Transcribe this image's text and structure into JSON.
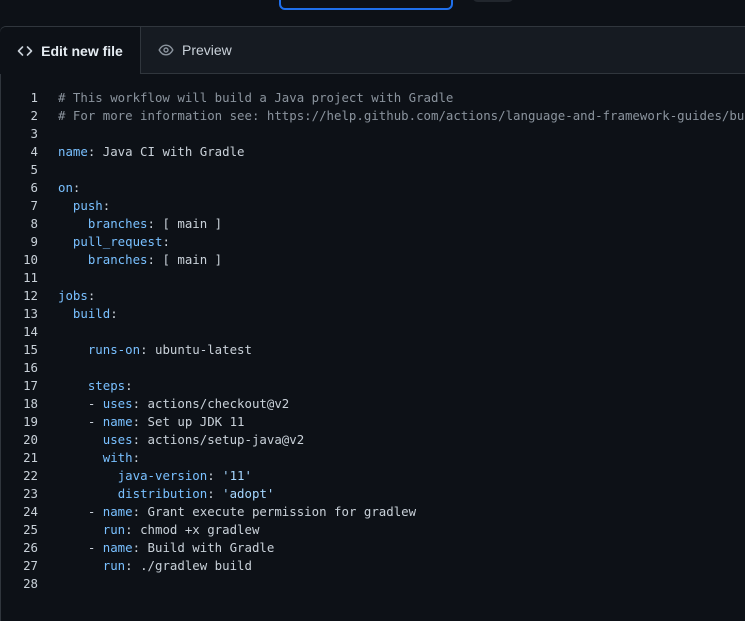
{
  "tabs": {
    "edit_label": "Edit new file",
    "preview_label": "Preview"
  },
  "code_lines": [
    [
      {
        "t": "c",
        "v": "# This workflow will build a Java project with Gradle"
      }
    ],
    [
      {
        "t": "c",
        "v": "# For more information see: https://help.github.com/actions/language-and-framework-guides/build"
      }
    ],
    [],
    [
      {
        "t": "k",
        "v": "name"
      },
      {
        "t": "p",
        "v": ": Java CI with Gradle"
      }
    ],
    [],
    [
      {
        "t": "k",
        "v": "on"
      },
      {
        "t": "p",
        "v": ":"
      }
    ],
    [
      {
        "t": "p",
        "v": "  "
      },
      {
        "t": "k",
        "v": "push"
      },
      {
        "t": "p",
        "v": ":"
      }
    ],
    [
      {
        "t": "p",
        "v": "    "
      },
      {
        "t": "k",
        "v": "branches"
      },
      {
        "t": "p",
        "v": ": [ main ]"
      }
    ],
    [
      {
        "t": "p",
        "v": "  "
      },
      {
        "t": "k",
        "v": "pull_request"
      },
      {
        "t": "p",
        "v": ":"
      }
    ],
    [
      {
        "t": "p",
        "v": "    "
      },
      {
        "t": "k",
        "v": "branches"
      },
      {
        "t": "p",
        "v": ": [ main ]"
      }
    ],
    [],
    [
      {
        "t": "k",
        "v": "jobs"
      },
      {
        "t": "p",
        "v": ":"
      }
    ],
    [
      {
        "t": "p",
        "v": "  "
      },
      {
        "t": "k",
        "v": "build"
      },
      {
        "t": "p",
        "v": ":"
      }
    ],
    [],
    [
      {
        "t": "p",
        "v": "    "
      },
      {
        "t": "k",
        "v": "runs-on"
      },
      {
        "t": "p",
        "v": ": ubuntu-latest"
      }
    ],
    [],
    [
      {
        "t": "p",
        "v": "    "
      },
      {
        "t": "k",
        "v": "steps"
      },
      {
        "t": "p",
        "v": ":"
      }
    ],
    [
      {
        "t": "p",
        "v": "    - "
      },
      {
        "t": "k",
        "v": "uses"
      },
      {
        "t": "p",
        "v": ": actions/checkout@v2"
      }
    ],
    [
      {
        "t": "p",
        "v": "    - "
      },
      {
        "t": "k",
        "v": "name"
      },
      {
        "t": "p",
        "v": ": Set up JDK 11"
      }
    ],
    [
      {
        "t": "p",
        "v": "      "
      },
      {
        "t": "k",
        "v": "uses"
      },
      {
        "t": "p",
        "v": ": actions/setup-java@v2"
      }
    ],
    [
      {
        "t": "p",
        "v": "      "
      },
      {
        "t": "k",
        "v": "with"
      },
      {
        "t": "p",
        "v": ":"
      }
    ],
    [
      {
        "t": "p",
        "v": "        "
      },
      {
        "t": "k",
        "v": "java-version"
      },
      {
        "t": "p",
        "v": ": "
      },
      {
        "t": "s",
        "v": "'11'"
      }
    ],
    [
      {
        "t": "p",
        "v": "        "
      },
      {
        "t": "k",
        "v": "distribution"
      },
      {
        "t": "p",
        "v": ": "
      },
      {
        "t": "s",
        "v": "'adopt'"
      }
    ],
    [
      {
        "t": "p",
        "v": "    - "
      },
      {
        "t": "k",
        "v": "name"
      },
      {
        "t": "p",
        "v": ": Grant execute permission for gradlew"
      }
    ],
    [
      {
        "t": "p",
        "v": "      "
      },
      {
        "t": "k",
        "v": "run"
      },
      {
        "t": "p",
        "v": ": chmod +x gradlew"
      }
    ],
    [
      {
        "t": "p",
        "v": "    - "
      },
      {
        "t": "k",
        "v": "name"
      },
      {
        "t": "p",
        "v": ": Build with Gradle"
      }
    ],
    [
      {
        "t": "p",
        "v": "      "
      },
      {
        "t": "k",
        "v": "run"
      },
      {
        "t": "p",
        "v": ": ./gradlew build"
      }
    ],
    []
  ],
  "colors": {
    "background": "#0d1117",
    "key": "#79c0ff",
    "comment": "#8b949e",
    "string": "#a5d6ff",
    "text": "#c9d1d9"
  }
}
